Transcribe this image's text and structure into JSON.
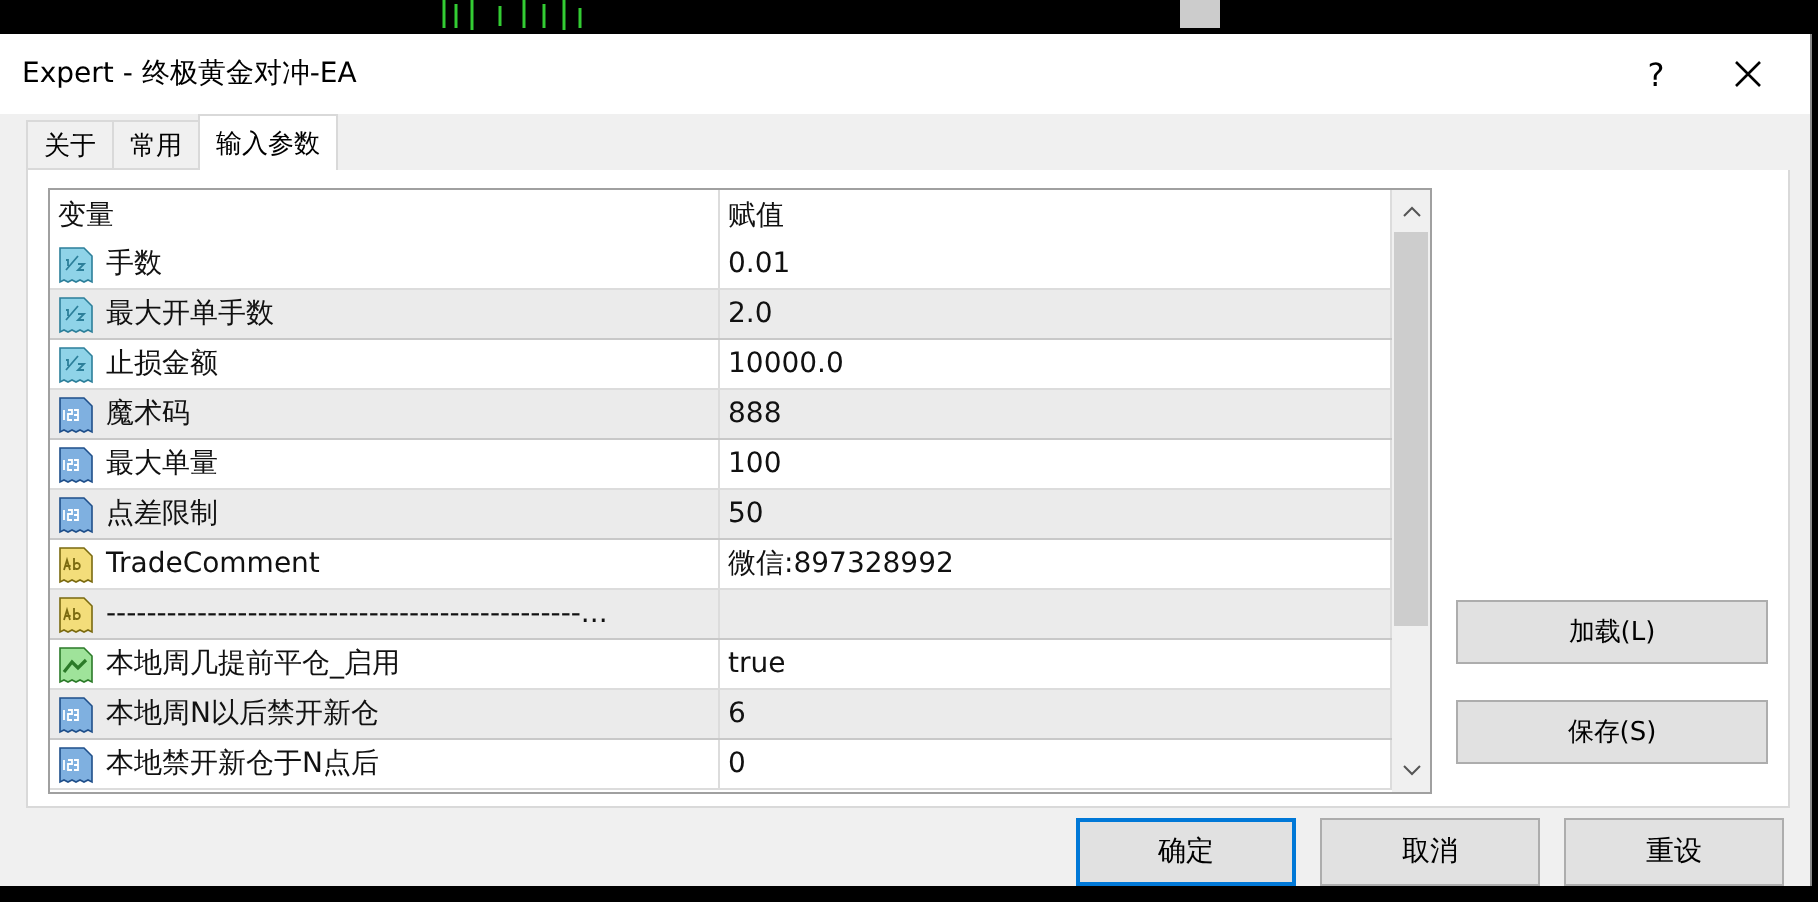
{
  "window": {
    "title": "Expert - 终极黄金对冲-EA",
    "help": "?"
  },
  "tabs": [
    {
      "label": "关于",
      "selected": false
    },
    {
      "label": "常用",
      "selected": false
    },
    {
      "label": "输入参数",
      "selected": true
    }
  ],
  "table": {
    "columns": [
      "变量",
      "赋值"
    ],
    "rows": [
      {
        "kind": "double",
        "name": "手数",
        "value": "0.01"
      },
      {
        "kind": "double",
        "name": "最大开单手数",
        "value": "2.0"
      },
      {
        "kind": "double",
        "name": "止损金额",
        "value": "10000.0"
      },
      {
        "kind": "int",
        "name": "魔术码",
        "value": "888"
      },
      {
        "kind": "int",
        "name": "最大单量",
        "value": "100"
      },
      {
        "kind": "int",
        "name": "点差限制",
        "value": "50"
      },
      {
        "kind": "string",
        "name": "TradeComment",
        "value": "微信:897328992"
      },
      {
        "kind": "string",
        "name": "-----------------------------------------------...",
        "value": ""
      },
      {
        "kind": "bool",
        "name": "本地周几提前平仓_启用",
        "value": "true"
      },
      {
        "kind": "int",
        "name": "本地周N以后禁开新仓",
        "value": "6"
      },
      {
        "kind": "int",
        "name": "本地禁开新仓于N点后",
        "value": "0"
      }
    ]
  },
  "side_buttons": [
    "加载(L)",
    "保存(S)"
  ],
  "buttons": [
    {
      "label": "确定",
      "default": true
    },
    {
      "label": "取消",
      "default": false
    },
    {
      "label": "重设",
      "default": false
    }
  ]
}
